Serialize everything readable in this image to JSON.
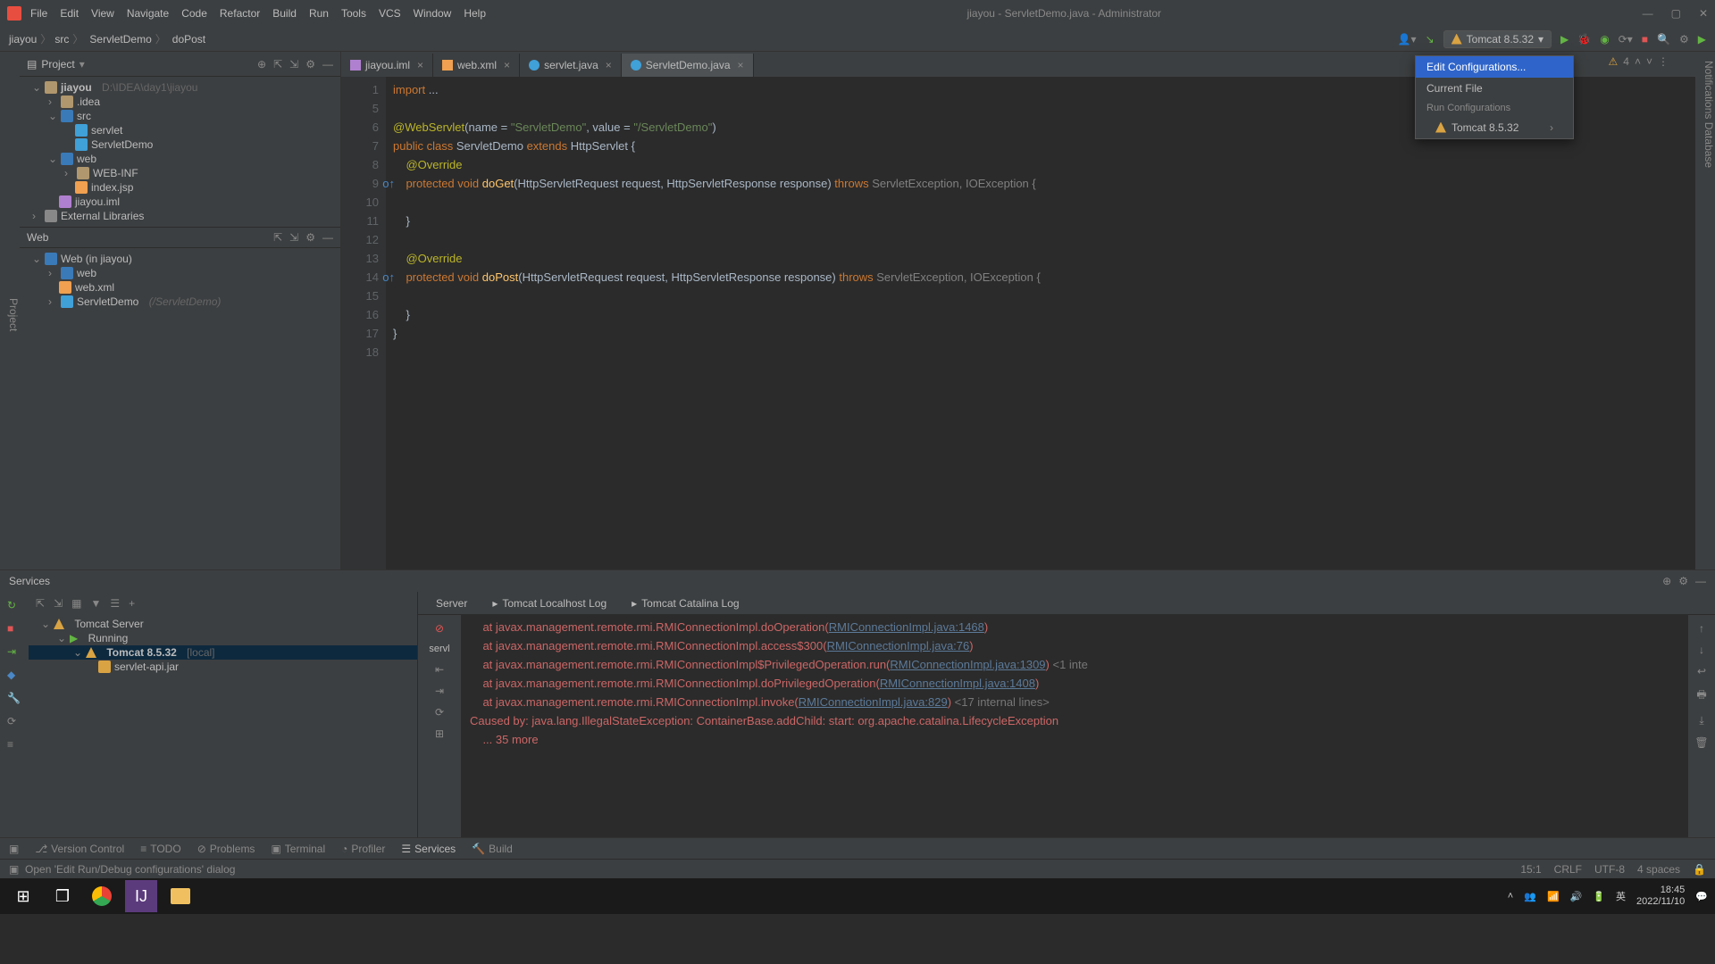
{
  "window": {
    "title": "jiayou - ServletDemo.java - Administrator"
  },
  "menu": {
    "file": "File",
    "edit": "Edit",
    "view": "View",
    "navigate": "Navigate",
    "code": "Code",
    "refactor": "Refactor",
    "build": "Build",
    "run": "Run",
    "tools": "Tools",
    "vcs": "VCS",
    "window": "Window",
    "help": "Help"
  },
  "breadcrumb": {
    "i0": "jiayou",
    "i1": "src",
    "i2": "ServletDemo",
    "i3": "doPost"
  },
  "run_config": {
    "selected": "Tomcat 8.5.32"
  },
  "run_dropdown": {
    "edit": "Edit Configurations...",
    "current": "Current File",
    "header": "Run Configurations",
    "item0": "Tomcat 8.5.32"
  },
  "project_panel": {
    "title": "Project"
  },
  "project_tree": {
    "root": "jiayou",
    "root_path": "D:\\IDEA\\day1\\jiayou",
    "idea": ".idea",
    "src": "src",
    "servlet": "servlet",
    "servletdemo": "ServletDemo",
    "web": "web",
    "webinf": "WEB-INF",
    "indexjsp": "index.jsp",
    "iml": "jiayou.iml",
    "extlib": "External Libraries"
  },
  "web_panel": {
    "title": "Web",
    "root": "Web (in jiayou)",
    "web": "web",
    "webxml": "web.xml",
    "servletdemo": "ServletDemo",
    "servletdemo_path": "(/ServletDemo)"
  },
  "tabs": {
    "t0": "jiayou.iml",
    "t1": "web.xml",
    "t2": "servlet.java",
    "t3": "ServletDemo.java"
  },
  "editor": {
    "lines": {
      "l1": "1",
      "l5": "5",
      "l6": "6",
      "l7": "7",
      "l8": "8",
      "l9": "9",
      "l10": "10",
      "l11": "11",
      "l12": "12",
      "l13": "13",
      "l14": "14",
      "l15": "15",
      "l16": "16",
      "l17": "17",
      "l18": "18"
    },
    "warnings": "4"
  },
  "code": {
    "import": "import",
    "elip": " ...",
    "ann_web": "@WebServlet",
    "paren_open": "(name = ",
    "str_name": "\"ServletDemo\"",
    "comma_val": ", value = ",
    "str_val": "\"/ServletDemo\"",
    "paren_close": ")",
    "public": "public ",
    "class": "class ",
    "cls_name": "ServletDemo ",
    "extends": "extends ",
    "super": "HttpServlet {",
    "override": "@Override",
    "protected": "protected ",
    "void": "void ",
    "doget": "doGet",
    "dopost": "doPost",
    "params": "(HttpServletRequest request, HttpServletResponse response) ",
    "throws": "throws ",
    "exceptions": "ServletException, IOException {",
    "close_brace": "    }",
    "close_brace_m": "}",
    "blank": ""
  },
  "services": {
    "title": "Services",
    "tree": {
      "tomcat_server": "Tomcat Server",
      "running": "Running",
      "tomcat": "Tomcat 8.5.32",
      "tomcat_local": "[local]",
      "jar": "servlet-api.jar"
    },
    "tabs": {
      "server": "Server",
      "localhost": "Tomcat Localhost Log",
      "catalina": "Tomcat Catalina Log"
    },
    "left_label": "servl"
  },
  "console": {
    "l1a": "    at javax.management.remote.rmi.RMIConnectionImpl.doOperation(",
    "l1b": "RMIConnectionImpl.java:1468",
    "l1c": ")",
    "l2a": "    at javax.management.remote.rmi.RMIConnectionImpl.access$300(",
    "l2b": "RMIConnectionImpl.java:76",
    "l2c": ")",
    "l3a": "    at javax.management.remote.rmi.RMIConnectionImpl$PrivilegedOperation.run(",
    "l3b": "RMIConnectionImpl.java:1309",
    "l3c": ") ",
    "l3d": "<1 inte",
    "l4a": "    at javax.management.remote.rmi.RMIConnectionImpl.doPrivilegedOperation(",
    "l4b": "RMIConnectionImpl.java:1408",
    "l4c": ")",
    "l5a": "    at javax.management.remote.rmi.RMIConnectionImpl.invoke(",
    "l5b": "RMIConnectionImpl.java:829",
    "l5c": ") ",
    "l5d": "<17 internal lines>",
    "l6": "Caused by: java.lang.IllegalStateException: ContainerBase.addChild: start: org.apache.catalina.LifecycleException",
    "l7": "    ... 35 more"
  },
  "bottom": {
    "version": "Version Control",
    "todo": "TODO",
    "problems": "Problems",
    "terminal": "Terminal",
    "profiler": "Profiler",
    "services": "Services",
    "build": "Build"
  },
  "status": {
    "msg": "Open 'Edit Run/Debug configurations' dialog",
    "pos": "15:1",
    "lf": "CRLF",
    "enc": "UTF-8",
    "indent": "4 spaces"
  },
  "taskbar": {
    "time": "18:45",
    "date": "2022/11/10"
  },
  "left_rail": {
    "project": "Project"
  },
  "right_rail": {
    "notif": "Notifications",
    "db": "Database"
  }
}
